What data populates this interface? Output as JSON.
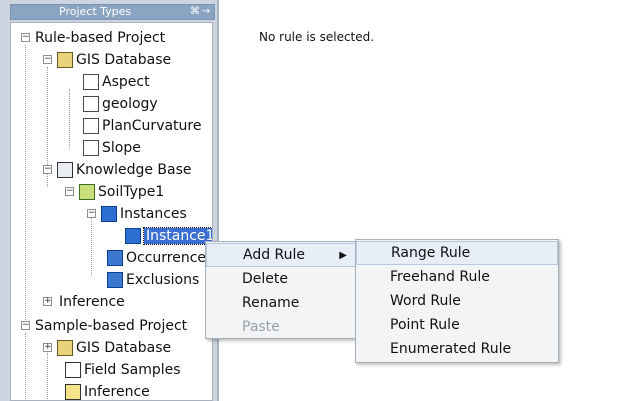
{
  "panel": {
    "title": "Project Types",
    "pin_glyph": "⌘",
    "more_glyph": "→"
  },
  "tree": {
    "items": [
      {
        "label": "Rule-based Project"
      },
      {
        "label": "GIS Database"
      },
      {
        "label": "Aspect"
      },
      {
        "label": "geology"
      },
      {
        "label": "PlanCurvature"
      },
      {
        "label": "Slope"
      },
      {
        "label": "Knowledge Base"
      },
      {
        "label": "SoilType1"
      },
      {
        "label": "Instances"
      },
      {
        "label": "Instance1"
      },
      {
        "label": "Occurrences"
      },
      {
        "label": "Exclusions"
      },
      {
        "label": "Inference"
      },
      {
        "label": "Sample-based Project"
      },
      {
        "label": "GIS Database"
      },
      {
        "label": "Field Samples"
      },
      {
        "label": "Inference"
      }
    ]
  },
  "right": {
    "no_rule_text": "No rule is selected."
  },
  "context_menu": {
    "items": [
      {
        "label": "Add Rule"
      },
      {
        "label": "Delete"
      },
      {
        "label": "Rename"
      },
      {
        "label": "Paste"
      }
    ],
    "submenu_arrow": "▶"
  },
  "submenu": {
    "items": [
      {
        "label": "Range Rule"
      },
      {
        "label": "Freehand Rule"
      },
      {
        "label": "Word Rule"
      },
      {
        "label": "Point Rule"
      },
      {
        "label": "Enumerated Rule"
      }
    ]
  },
  "colors": {
    "selection": "#3b6fcf",
    "panel_header": "#8aa4c2",
    "background": "#d7dce3"
  }
}
